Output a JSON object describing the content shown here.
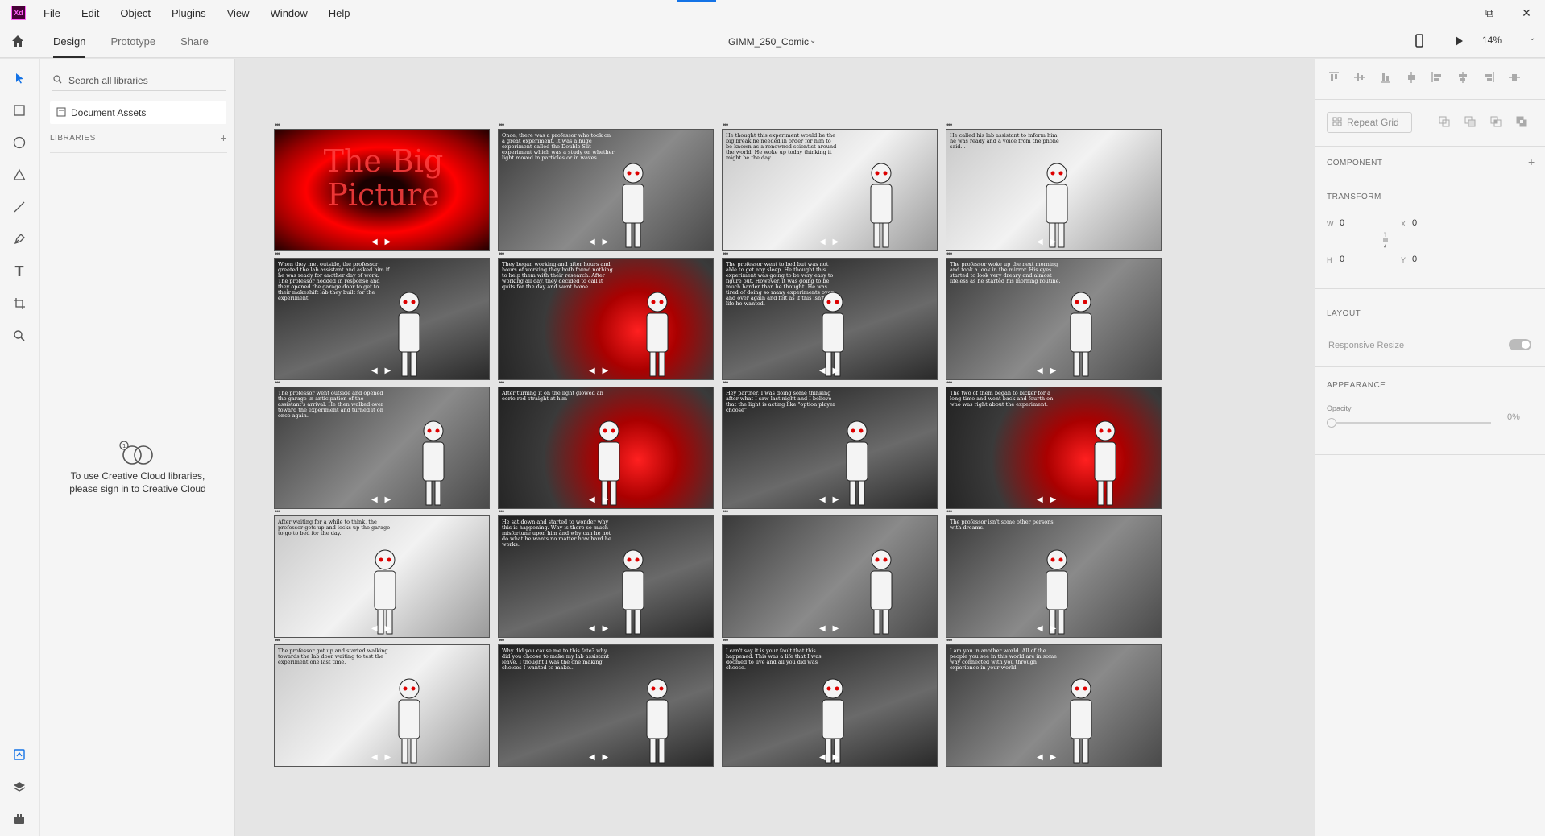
{
  "app": {
    "logo_text": "Xd"
  },
  "menu": [
    "File",
    "Edit",
    "Object",
    "Plugins",
    "View",
    "Window",
    "Help"
  ],
  "tabs": {
    "design": "Design",
    "prototype": "Prototype",
    "share": "Share"
  },
  "document": {
    "title": "GIMM_250_Comic"
  },
  "zoom": "14%",
  "libraries": {
    "search_placeholder": "Search all libraries",
    "document_assets": "Document Assets",
    "header": "LIBRARIES",
    "cloud_message_line1": "To use Creative Cloud libraries,",
    "cloud_message_line2": "please sign in to Creative Cloud"
  },
  "properties": {
    "repeat_grid": "Repeat Grid",
    "component": "COMPONENT",
    "transform": "TRANSFORM",
    "w_label": "W",
    "w_value": "0",
    "h_label": "H",
    "h_value": "0",
    "x_label": "X",
    "x_value": "0",
    "y_label": "Y",
    "y_value": "0",
    "layout": "LAYOUT",
    "responsive_resize": "Responsive Resize",
    "appearance": "APPEARANCE",
    "opacity_label": "Opacity",
    "opacity_value": "0%"
  },
  "comic_panels": [
    {
      "text": "The Big Picture",
      "theme": "red"
    },
    {
      "text": "Once, there was a professor who took on a great experiment. It was a huge experiment called the Double Slit experiment which was a study on whether light moved in particles or in waves.",
      "theme": "gray"
    },
    {
      "text": "He thought this experiment would be the big break he needed in order for him to be known as a renowned scientist around the world. He woke up today thinking it might be the day.",
      "theme": "light"
    },
    {
      "text": "He called his lab assistant to inform him he was ready and a voice from the phone said...",
      "theme": "light"
    },
    {
      "text": "When they met outside, the professor greeted the lab assistant and asked him if he was ready for another day of work. The professor nodded in response and they opened the garage door to get to their makeshift lab they built for the experiment.",
      "theme": "dark"
    },
    {
      "text": "They began working and after hours and hours of working they both found nothing to help them with their research. After working all day, they decided to call it quits for the day and went home.",
      "theme": "redglow"
    },
    {
      "text": "The professor went to bed but was not able to get any sleep. He thought this experiment was going to be very easy to figure out. However, it was going to be much harder than he thought. He was tired of doing so many experiments over and over again and felt as if this isn't the life he wanted.",
      "theme": "dark"
    },
    {
      "text": "The professor woke up the next morning and took a look in the mirror. His eyes started to look very dreary and almost lifeless as he started his morning routine.",
      "theme": "gray"
    },
    {
      "text": "The professor went outside and opened the garage in anticipation of the assistant's arrival. He then walked over toward the experiment and turned it on once again.",
      "theme": "gray"
    },
    {
      "text": "After turning it on the light glowed an eerie red straight at him",
      "theme": "redglow"
    },
    {
      "text": "Hey partner, I was doing some thinking after what I saw last night and I believe that the light is acting like \"option player choose\"",
      "theme": "dark"
    },
    {
      "text": "The two of them began to bicker for a long time and went back and fourth on who was right about the experiment.",
      "theme": "redglow"
    },
    {
      "text": "After waiting for a while to think, the professor gets up and locks up the garage to go to bed for the day.",
      "theme": "light"
    },
    {
      "text": "He sat down and started to wonder why this is happening. Why is there so much misfortune upon him and why can he not do what he wants no matter how hard he works.",
      "theme": "dark"
    },
    {
      "text": "",
      "theme": "gray"
    },
    {
      "text": "The professor isn't some other persons with dreams.",
      "theme": "gray"
    },
    {
      "text": "The professor got up and started walking towards the lab door waiting to test the experiment one last time.",
      "theme": "light"
    },
    {
      "text": "Why did you cause me to this fate? why did you choose to make my lab assistant leave. I thought I was the one making choices I wanted to make...",
      "theme": "dark"
    },
    {
      "text": "I can't say it is your fault that this happened. This was a life that I was doomed to live and all you did was choose.",
      "theme": "dark"
    },
    {
      "text": "I am you in another world. All of the people you see in this world are in some way connected with you through experience in your world.",
      "theme": "gray"
    }
  ]
}
